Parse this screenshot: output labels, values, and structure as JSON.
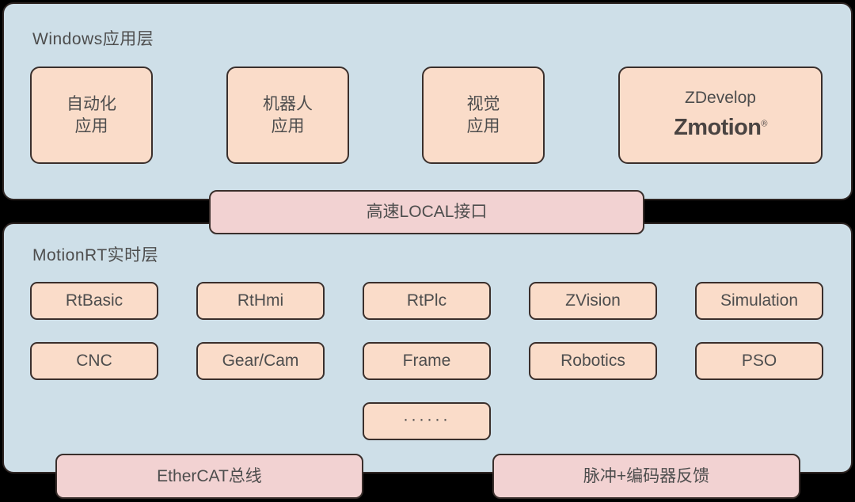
{
  "windows_layer": {
    "title": "Windows应用层",
    "apps": [
      {
        "name": "automation-app",
        "lines": [
          "自动化",
          "应用"
        ]
      },
      {
        "name": "robot-app",
        "lines": [
          "机器人",
          "应用"
        ]
      },
      {
        "name": "vision-app",
        "lines": [
          "视觉",
          "应用"
        ]
      },
      {
        "name": "zdevelop-app",
        "label": "ZDevelop",
        "logo": "Zmotion",
        "logo_mark": "®"
      }
    ]
  },
  "connector": {
    "local_interface": "高速LOCAL接口"
  },
  "motionrt_layer": {
    "title": "MotionRT实时层",
    "modules_row0": [
      "RtBasic",
      "RtHmi",
      "RtPlc",
      "ZVision",
      "Simulation"
    ],
    "modules_row1": [
      "CNC",
      "Gear/Cam",
      "Frame",
      "Robotics",
      "PSO"
    ],
    "more": "······"
  },
  "buses": {
    "ethercat": "EtherCAT总线",
    "pulse_encoder": "脉冲+编码器反馈"
  },
  "colors": {
    "page_background": "#000000",
    "panel_fill": "#cedfe8",
    "node_fill": "#fadcc9",
    "connector_fill": "#f2d2d2",
    "border": "#3a2f2c",
    "text": "#4d4d4d"
  }
}
